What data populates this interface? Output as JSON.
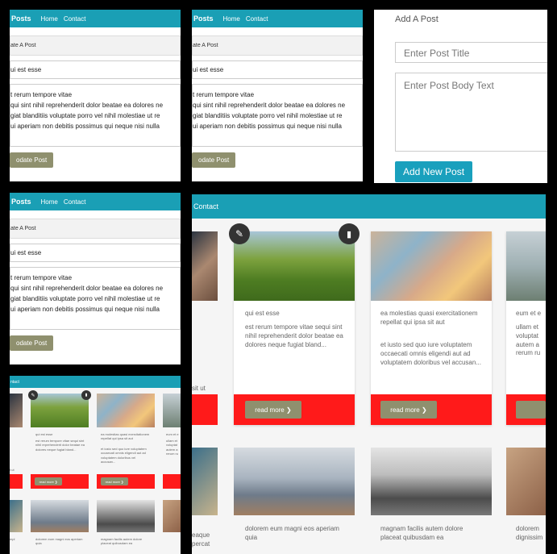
{
  "panels": {
    "edit_form": {
      "nav": {
        "brand": "Posts",
        "home": "Home",
        "contact": "Contact"
      },
      "card_header": "ate A Post",
      "title_value": "ui est esse",
      "body_lines": [
        "t rerum tempore vitae",
        "qui sint nihil reprehenderit dolor beatae ea dolores ne",
        "giat blanditiis voluptate porro vel nihil molestiae ut re",
        "ui aperiam non debitis possimus qui neque nisi nulla"
      ],
      "button": "odate Post"
    },
    "new_post": {
      "card_header": "Add A Post",
      "title_placeholder": "Enter Post Title",
      "body_placeholder": "Enter Post Body Text",
      "button": "Add New Post"
    },
    "list": {
      "nav_link": "Contact",
      "cards": [
        {
          "title": "qui est esse",
          "body": "est rerum tempore vitae sequi sint nihil reprehenderit dolor beatae ea dolores neque fugiat bland..."
        },
        {
          "title": "ea molestias quasi exercitationem repellat qui ipsa sit aut",
          "body": "et iusto sed quo iure voluptatem occaecati omnis eligendi aut ad voluptatem doloribus vel accusan..."
        },
        {
          "title": "eum et e",
          "body": "ullam et voluptat autem a rerum ru"
        }
      ],
      "edge_text": "sit ut",
      "read_more": "read more",
      "bottom_titles": [
        "dolorem eum magni eos aperiam quia",
        "magnam facilis autem dolore placeat quibusdam ea",
        "dolorem dignissim"
      ],
      "bottom_left_text": "eaque\npercat"
    },
    "small_list": {
      "nav_link": "ntact",
      "card1_title": "qui est esse",
      "card1_body": "est rerum tempore vitae sequi sint nihil reprehenderit dolor beatae ea dolores neque fugiat bland...",
      "card2_title": "ea molestias quasi exercitationem repellat qui ipsa sit aut",
      "card2_body": "et iusto sed quo iure voluptatem occaecati omnis eligendi aut ad voluptatem doloribus vel accusan...",
      "card3_title": "eum et e",
      "card3_body": "ullam et voluptat autem a rerum ru",
      "edge_text": "t ut",
      "read_more": "read more",
      "bottom_title1": "dolorem eum magni eos aperiam quia",
      "bottom_title2": "magnam facilis autem dolore placeat quibusdam ea",
      "bottom_left_text": "mpl"
    }
  },
  "colors": {
    "accent": "#1a9fb5",
    "button_olive": "#8f906e",
    "red": "#ff1a1a"
  }
}
